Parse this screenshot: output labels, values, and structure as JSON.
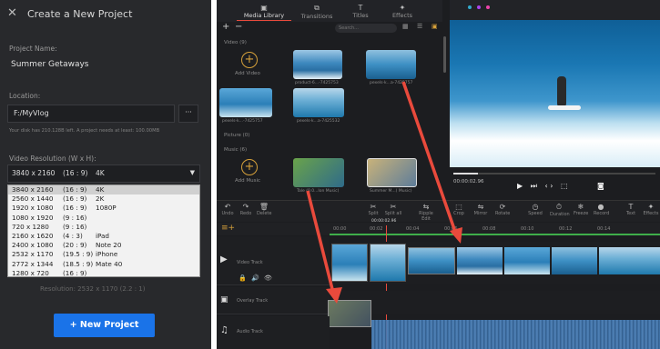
{
  "dialog": {
    "title": "Create a New Project",
    "project_name_label": "Project Name:",
    "project_name_value": "Summer Getaways",
    "location_label": "Location:",
    "location_value": "F:/MyVlog",
    "browse_label": "···",
    "disk_info": "Your disk has 210.128B left. A project needs at least: 100.00MB",
    "resolution_label": "Video Resolution (W x H):",
    "selected_resolution": [
      "3840 x 2160",
      "(16 : 9)",
      "4K"
    ],
    "options": [
      [
        "3840 x 2160",
        "(16 : 9)",
        "4K"
      ],
      [
        "2560 x 1440",
        "(16 : 9)",
        "2K"
      ],
      [
        "1920 x 1080",
        "(16 : 9)",
        "1080P"
      ],
      [
        "1080 x 1920",
        "(9 : 16)",
        ""
      ],
      [
        "720 x 1280",
        "(9 : 16)",
        ""
      ],
      [
        "2160 x 1620",
        "(4 : 3)",
        "iPad"
      ],
      [
        "2400 x 1080",
        "(20 : 9)",
        "Note 20"
      ],
      [
        "2532 x 1170",
        "(19.5 : 9)",
        "iPhone"
      ],
      [
        "2772 x 1344",
        "(18.5 : 9)",
        "Mate 40"
      ],
      [
        "1280 x 720",
        "(16 : 9)",
        ""
      ]
    ],
    "resolution_hint": "Resolution: 2532 x 1170 (2.2 : 1)",
    "new_project_label": "New Project"
  },
  "editor": {
    "tabs": [
      "Media Library",
      "Transitions",
      "Titles",
      "Effects"
    ],
    "search_placeholder": "Search...",
    "video_section": "Video (9)",
    "picture_section": "Picture (0)",
    "music_section": "Music (6)",
    "add_video": "Add Video",
    "add_music": "Add Music",
    "clips": [
      "product-6...-7425753",
      "pexels-k...a-7425757",
      "pexels-k...-7425757",
      "pexels-k...a-7425532"
    ],
    "music_items": [
      "Tale (0.0...Ion Music)",
      "Summer M...( Music)"
    ],
    "time_code": "00:00:02.96",
    "timeline_time": "00:00:02.96",
    "track_names": [
      "Video Track",
      "Overlay Track",
      "Audio Track"
    ],
    "toolbar_items": [
      "Undo",
      "Redo",
      "Delete",
      "Split",
      "Split all",
      "Ripple Edit",
      "Crop",
      "Mirror",
      "Rotate",
      "Speed",
      "Duration",
      "Freeze",
      "Record",
      "Text",
      "Effects"
    ],
    "ticks": [
      "00:00",
      "00:02",
      "00:04",
      "00:06",
      "00:08",
      "00:10",
      "00:12",
      "00:14"
    ]
  },
  "colors": {
    "accent_blue": "#1a73e8",
    "arrow_red": "#e94a3c",
    "panel_dark": "#28292c"
  }
}
